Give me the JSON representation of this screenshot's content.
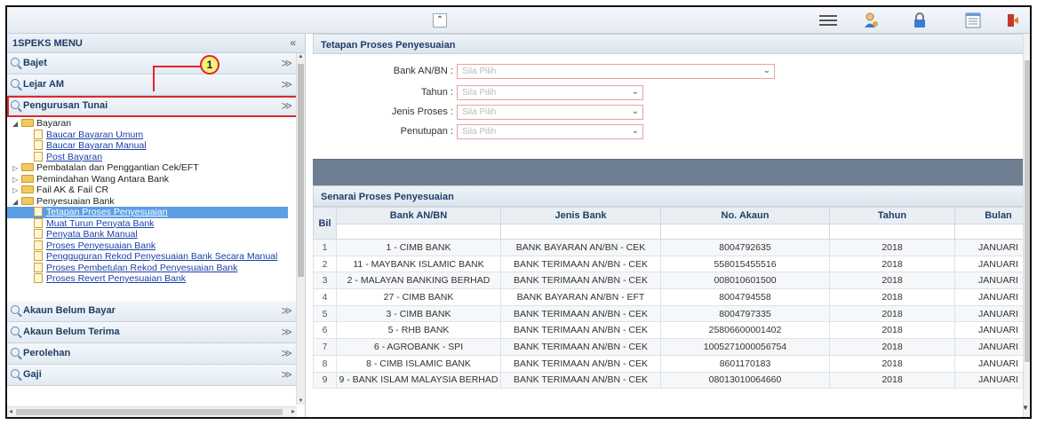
{
  "topbar": {
    "collapse_glyph": "«",
    "icons": [
      "hamburger-icon",
      "user-icon",
      "lock-icon",
      "list-icon",
      "logout-icon"
    ]
  },
  "sidebar": {
    "title": "1SPEKS MENU",
    "collapse_glyph": "«",
    "expand_glyph": "»",
    "accordions_top": [
      {
        "label": "Bajet"
      },
      {
        "label": "Lejar AM"
      },
      {
        "label": "Pengurusan Tunai"
      }
    ],
    "tree": [
      {
        "level": 1,
        "expanded": true,
        "label": "Bayaran"
      },
      {
        "level": 2,
        "label": "Baucar Bayaran Umum"
      },
      {
        "level": 2,
        "label": "Baucar Bayaran Manual"
      },
      {
        "level": 2,
        "label": "Post Bayaran"
      },
      {
        "level": 1,
        "expanded": false,
        "label": "Pembatalan dan Penggantian Cek/EFT"
      },
      {
        "level": 1,
        "expanded": false,
        "label": "Pemindahan Wang Antara Bank"
      },
      {
        "level": 1,
        "expanded": false,
        "label": "Fail AK & Fail CR"
      },
      {
        "level": 1,
        "expanded": true,
        "label": "Penyesuaian Bank"
      },
      {
        "level": 2,
        "label": "Tetapan Proses Penyesuaian",
        "selected": true
      },
      {
        "level": 2,
        "label": "Muat Turun Penyata Bank"
      },
      {
        "level": 2,
        "label": "Penyata Bank Manual"
      },
      {
        "level": 2,
        "label": "Proses Penyesuaian Bank"
      },
      {
        "level": 2,
        "label": "Pengguguran Rekod Penyesuaian Bank Secara Manual"
      },
      {
        "level": 2,
        "label": "Proses Pembetulan Rekod Penyesuaian Bank"
      },
      {
        "level": 2,
        "label": "Proses Revert Penyesuaian Bank"
      }
    ],
    "accordions_bottom": [
      {
        "label": "Akaun Belum Bayar"
      },
      {
        "label": "Akaun Belum Terima"
      },
      {
        "label": "Perolehan"
      },
      {
        "label": "Gaji"
      }
    ]
  },
  "callout": {
    "number": "1"
  },
  "settings_panel": {
    "title": "Tetapan Proses Penyesuaian",
    "fields": [
      {
        "label": "Bank AN/BN :",
        "placeholder": "Sila Pilih"
      },
      {
        "label": "Tahun :",
        "placeholder": "Sila Pilih"
      },
      {
        "label": "Jenis Proses :",
        "placeholder": "Sila Pilih"
      },
      {
        "label": "Penutupan :",
        "placeholder": "Sila Pilih"
      }
    ]
  },
  "list_panel": {
    "title": "Senarai Proses Penyesuaian",
    "columns": [
      "Bil",
      "Bank AN/BN",
      "Jenis Bank",
      "No. Akaun",
      "Tahun",
      "Bulan"
    ],
    "rows": [
      [
        "1",
        "1 - CIMB BANK",
        "BANK BAYARAN AN/BN - CEK",
        "8004792635",
        "2018",
        "JANUARI"
      ],
      [
        "2",
        "11 - MAYBANK ISLAMIC BANK",
        "BANK TERIMAAN AN/BN - CEK",
        "558015455516",
        "2018",
        "JANUARI"
      ],
      [
        "3",
        "2 - MALAYAN BANKING BERHAD",
        "BANK TERIMAAN AN/BN - CEK",
        "008010601500",
        "2018",
        "JANUARI"
      ],
      [
        "4",
        "27 - CIMB BANK",
        "BANK BAYARAN AN/BN - EFT",
        "8004794558",
        "2018",
        "JANUARI"
      ],
      [
        "5",
        "3 - CIMB BANK",
        "BANK TERIMAAN AN/BN - CEK",
        "8004797335",
        "2018",
        "JANUARI"
      ],
      [
        "6",
        "5 - RHB BANK",
        "BANK TERIMAAN AN/BN - CEK",
        "25806600001402",
        "2018",
        "JANUARI"
      ],
      [
        "7",
        "6 - AGROBANK - SPI",
        "BANK TERIMAAN AN/BN - CEK",
        "1005271000056754",
        "2018",
        "JANUARI"
      ],
      [
        "8",
        "8 - CIMB ISLAMIC BANK",
        "BANK TERIMAAN AN/BN - CEK",
        "8601170183",
        "2018",
        "JANUARI"
      ],
      [
        "9",
        "9 - BANK ISLAM MALAYSIA BERHAD",
        "BANK TERIMAAN AN/BN - CEK",
        "08013010064660",
        "2018",
        "JANUARI"
      ]
    ]
  },
  "colors": {
    "highlight_red": "#e0262b",
    "selected_blue": "#5b9ee6",
    "header_text": "#1f3f66",
    "dark_band": "#6e7f92"
  }
}
